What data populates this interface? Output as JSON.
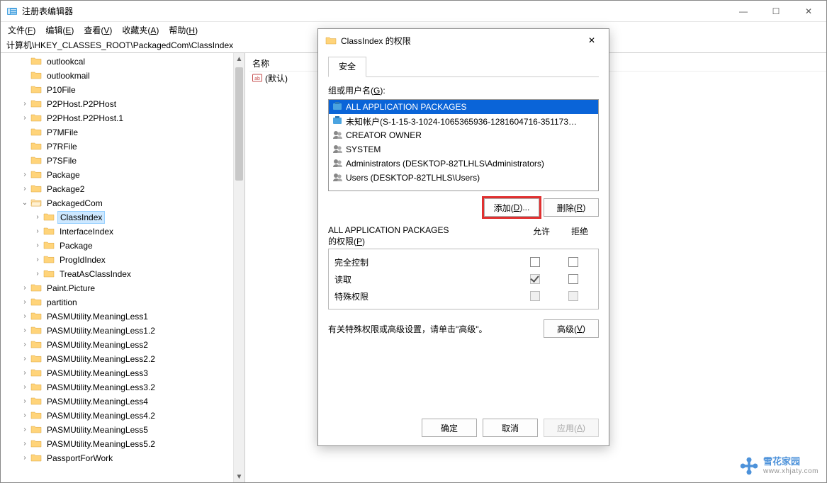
{
  "window": {
    "title": "注册表编辑器",
    "minimize": "—",
    "maximize": "☐",
    "close": "✕"
  },
  "menu": [
    {
      "label": "文件",
      "key": "F"
    },
    {
      "label": "编辑",
      "key": "E"
    },
    {
      "label": "查看",
      "key": "V"
    },
    {
      "label": "收藏夹",
      "key": "A"
    },
    {
      "label": "帮助",
      "key": "H"
    }
  ],
  "address": "计算机\\HKEY_CLASSES_ROOT\\PackagedCom\\ClassIndex",
  "tree": [
    {
      "indent": 1,
      "exp": "",
      "label": "outlookcal"
    },
    {
      "indent": 1,
      "exp": "",
      "label": "outlookmail"
    },
    {
      "indent": 1,
      "exp": "",
      "label": "P10File"
    },
    {
      "indent": 1,
      "exp": ">",
      "label": "P2PHost.P2PHost"
    },
    {
      "indent": 1,
      "exp": ">",
      "label": "P2PHost.P2PHost.1"
    },
    {
      "indent": 1,
      "exp": "",
      "label": "P7MFile"
    },
    {
      "indent": 1,
      "exp": "",
      "label": "P7RFile"
    },
    {
      "indent": 1,
      "exp": "",
      "label": "P7SFile"
    },
    {
      "indent": 1,
      "exp": ">",
      "label": "Package"
    },
    {
      "indent": 1,
      "exp": ">",
      "label": "Package2"
    },
    {
      "indent": 1,
      "exp": "v",
      "label": "PackagedCom",
      "open": true
    },
    {
      "indent": 2,
      "exp": ">",
      "label": "ClassIndex",
      "selected": true
    },
    {
      "indent": 2,
      "exp": ">",
      "label": "InterfaceIndex"
    },
    {
      "indent": 2,
      "exp": ">",
      "label": "Package"
    },
    {
      "indent": 2,
      "exp": ">",
      "label": "ProgIdIndex"
    },
    {
      "indent": 2,
      "exp": ">",
      "label": "TreatAsClassIndex"
    },
    {
      "indent": 1,
      "exp": ">",
      "label": "Paint.Picture"
    },
    {
      "indent": 1,
      "exp": ">",
      "label": "partition"
    },
    {
      "indent": 1,
      "exp": ">",
      "label": "PASMUtility.MeaningLess1"
    },
    {
      "indent": 1,
      "exp": ">",
      "label": "PASMUtility.MeaningLess1.2"
    },
    {
      "indent": 1,
      "exp": ">",
      "label": "PASMUtility.MeaningLess2"
    },
    {
      "indent": 1,
      "exp": ">",
      "label": "PASMUtility.MeaningLess2.2"
    },
    {
      "indent": 1,
      "exp": ">",
      "label": "PASMUtility.MeaningLess3"
    },
    {
      "indent": 1,
      "exp": ">",
      "label": "PASMUtility.MeaningLess3.2"
    },
    {
      "indent": 1,
      "exp": ">",
      "label": "PASMUtility.MeaningLess4"
    },
    {
      "indent": 1,
      "exp": ">",
      "label": "PASMUtility.MeaningLess4.2"
    },
    {
      "indent": 1,
      "exp": ">",
      "label": "PASMUtility.MeaningLess5"
    },
    {
      "indent": 1,
      "exp": ">",
      "label": "PASMUtility.MeaningLess5.2"
    },
    {
      "indent": 1,
      "exp": ">",
      "label": "PassportForWork"
    }
  ],
  "list": {
    "header": "名称",
    "default_value": "(默认)"
  },
  "dialog": {
    "title": "ClassIndex 的权限",
    "close": "✕",
    "tab": "安全",
    "group_label_pre": "组或用户名(",
    "group_label_key": "G",
    "group_label_post": "):",
    "users": [
      {
        "icon": "pkg",
        "name": "ALL APPLICATION PACKAGES",
        "selected": true
      },
      {
        "icon": "pkg",
        "name": "未知帐户(S-1-15-3-1024-1065365936-1281604716-351173…"
      },
      {
        "icon": "grp",
        "name": "CREATOR OWNER"
      },
      {
        "icon": "grp",
        "name": "SYSTEM"
      },
      {
        "icon": "grp",
        "name": "Administrators (DESKTOP-82TLHLS\\Administrators)"
      },
      {
        "icon": "grp",
        "name": "Users (DESKTOP-82TLHLS\\Users)"
      }
    ],
    "add_btn_pre": "添加(",
    "add_btn_key": "D",
    "add_btn_post": ")...",
    "remove_btn_pre": "删除(",
    "remove_btn_key": "R",
    "remove_btn_post": ")",
    "perm_title_line1": "ALL APPLICATION PACKAGES",
    "perm_title_pre": "的权限(",
    "perm_title_key": "P",
    "perm_title_post": ")",
    "allow": "允许",
    "deny": "拒绝",
    "perms": [
      {
        "name": "完全控制",
        "allow": false,
        "deny": false,
        "allow_disabled": false,
        "deny_disabled": false
      },
      {
        "name": "读取",
        "allow": true,
        "deny": false,
        "allow_disabled": true,
        "deny_disabled": false
      },
      {
        "name": "特殊权限",
        "allow": false,
        "deny": false,
        "allow_disabled": true,
        "deny_disabled": true
      }
    ],
    "adv_text": "有关特殊权限或高级设置，请单击\"高级\"。",
    "adv_btn_pre": "高级(",
    "adv_btn_key": "V",
    "adv_btn_post": ")",
    "ok": "确定",
    "cancel": "取消",
    "apply_pre": "应用(",
    "apply_key": "A",
    "apply_post": ")"
  },
  "watermark": {
    "line1": "雪花家园",
    "line2": "www.xhjaty.com"
  }
}
